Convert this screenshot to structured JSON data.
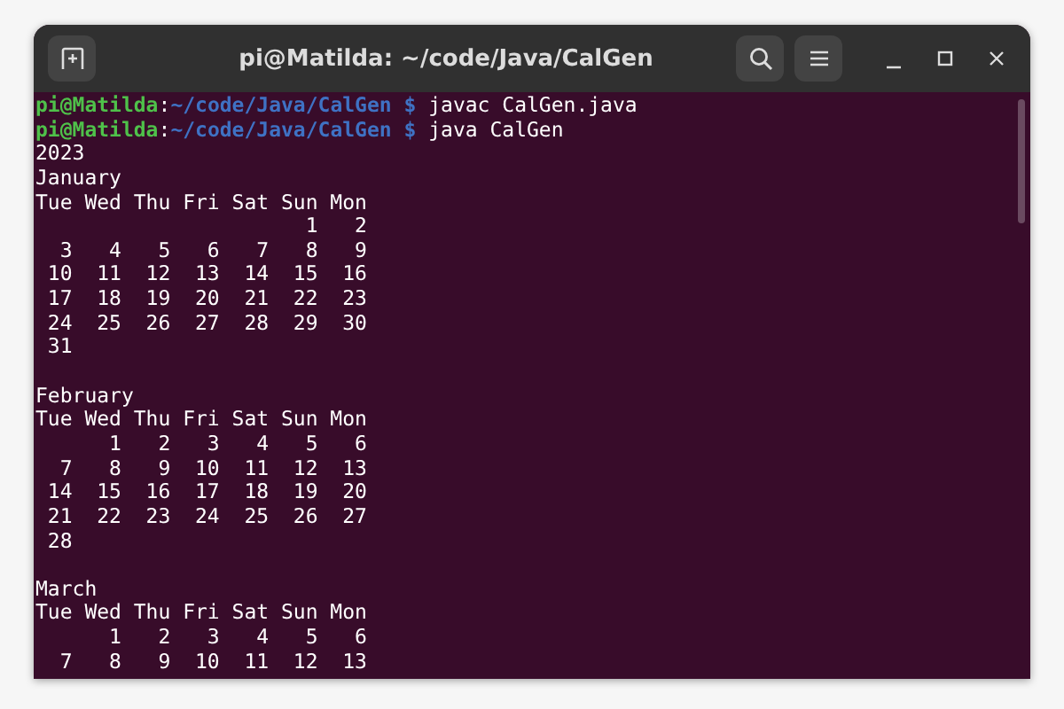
{
  "window": {
    "title": "pi@Matilda: ~/code/Java/CalGen"
  },
  "prompts": [
    {
      "user_host": "pi@Matilda",
      "separator": ":",
      "path": "~/code/Java/CalGen",
      "symbol": "$",
      "command": "javac CalGen.java"
    },
    {
      "user_host": "pi@Matilda",
      "separator": ":",
      "path": "~/code/Java/CalGen",
      "symbol": "$",
      "command": "java CalGen"
    }
  ],
  "year": "2023",
  "months": [
    {
      "name": "January",
      "header": "Tue Wed Thu Fri Sat Sun Mon",
      "rows": [
        "                      1   2",
        "  3   4   5   6   7   8   9",
        " 10  11  12  13  14  15  16",
        " 17  18  19  20  21  22  23",
        " 24  25  26  27  28  29  30",
        " 31"
      ]
    },
    {
      "name": "February",
      "header": "Tue Wed Thu Fri Sat Sun Mon",
      "rows": [
        "      1   2   3   4   5   6",
        "  7   8   9  10  11  12  13",
        " 14  15  16  17  18  19  20",
        " 21  22  23  24  25  26  27",
        " 28"
      ]
    },
    {
      "name": "March",
      "header": "Tue Wed Thu Fri Sat Sun Mon",
      "rows": [
        "      1   2   3   4   5   6",
        "  7   8   9  10  11  12  13"
      ]
    }
  ]
}
